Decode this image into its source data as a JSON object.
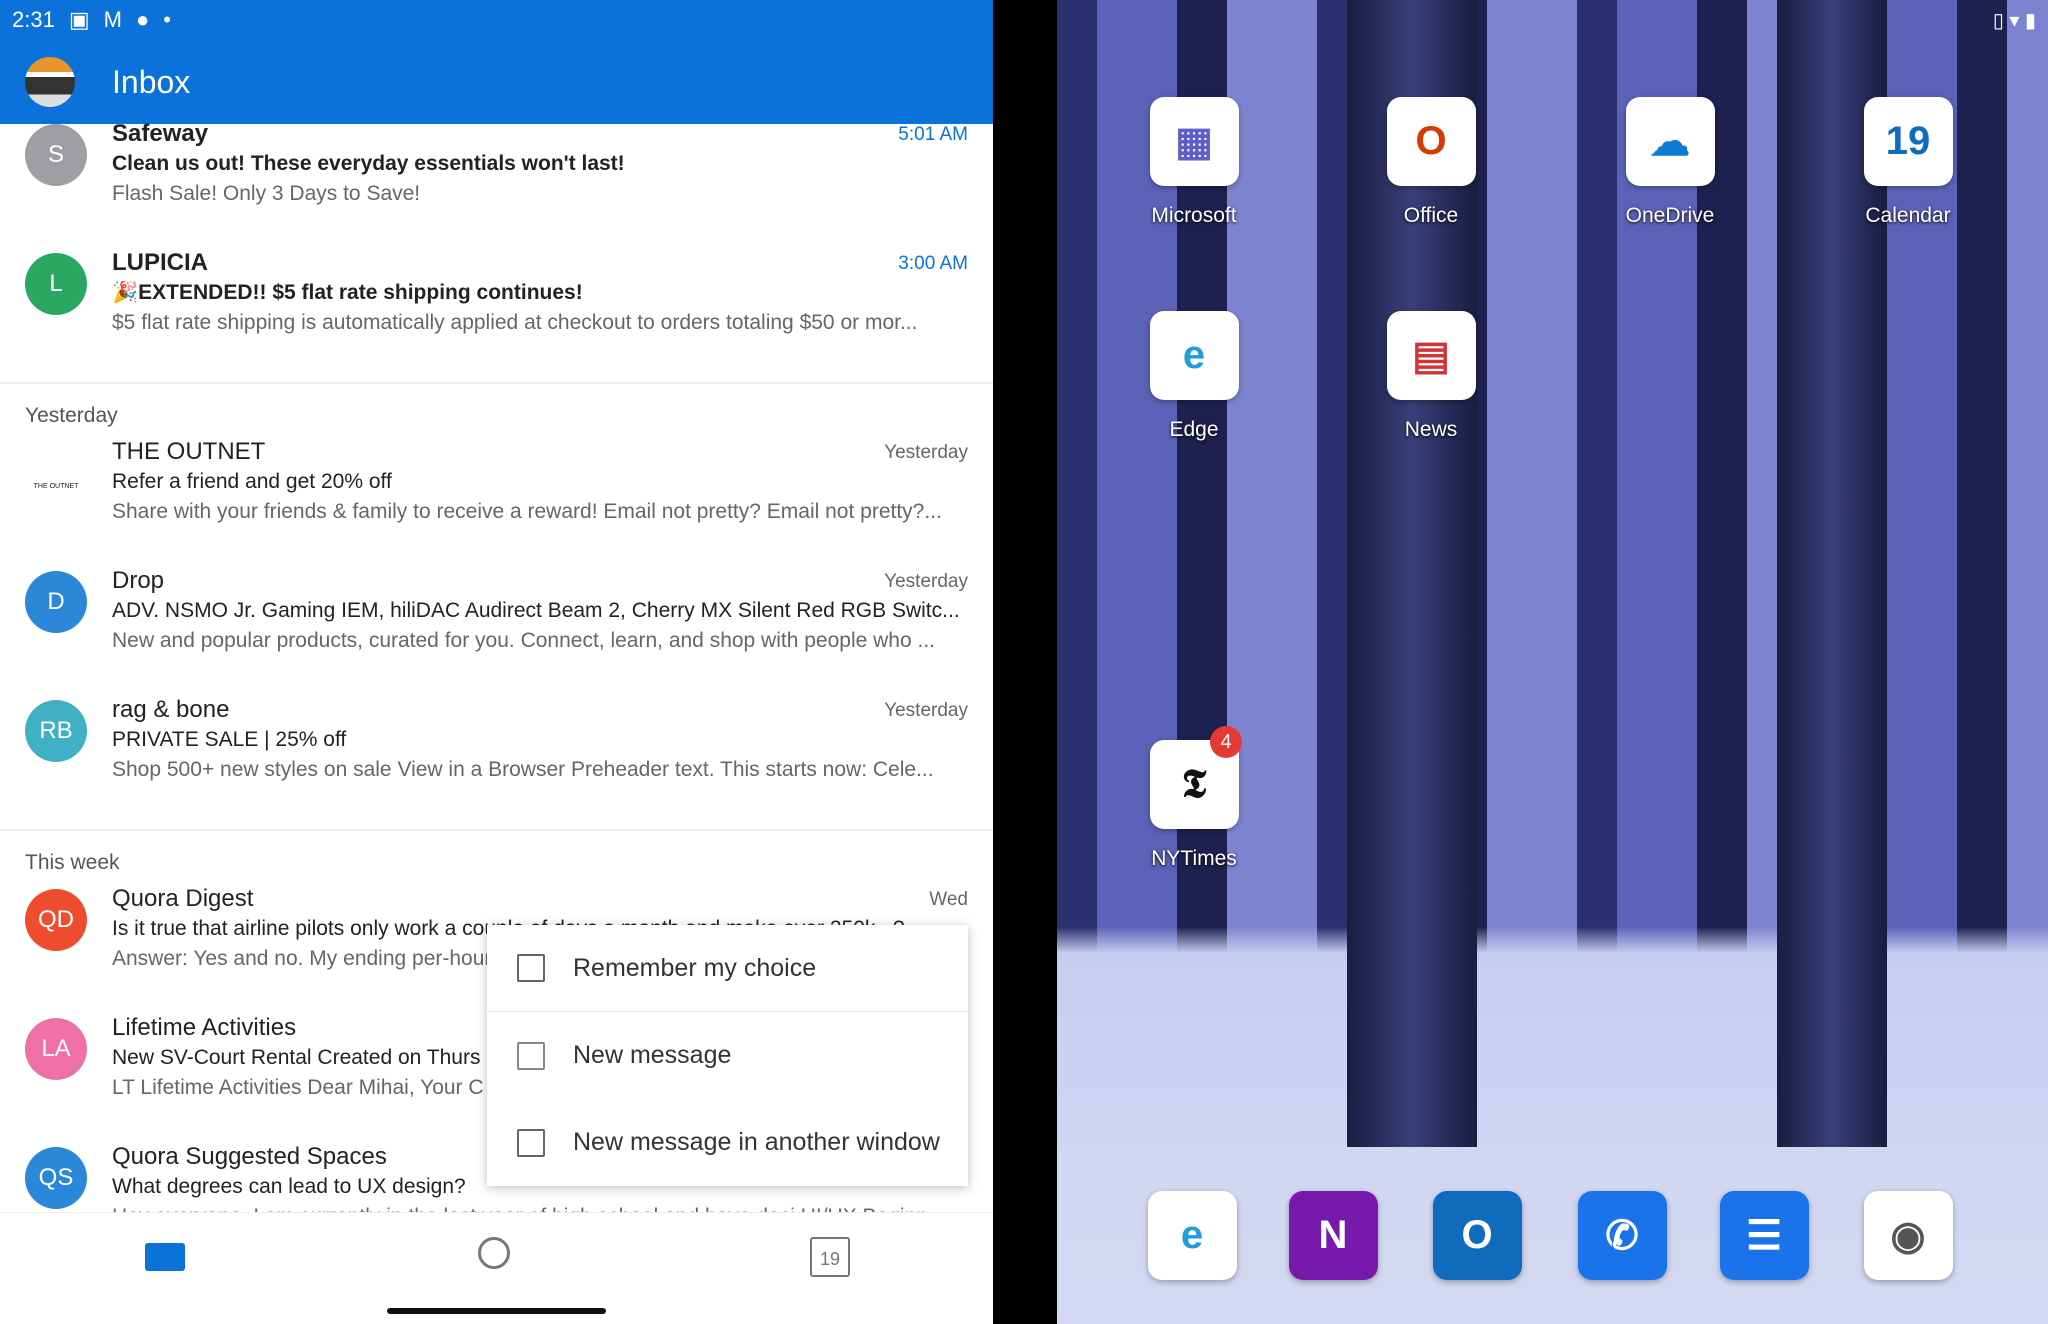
{
  "status_bar": {
    "time": "2:31",
    "right_icons": [
      "vibrate-icon",
      "wifi-icon",
      "battery-icon"
    ]
  },
  "header": {
    "title": "Inbox"
  },
  "emails": [
    {
      "avatar": "S",
      "color": "#9e9ea3",
      "sender": "Safeway",
      "subject": "Clean us out! These everyday essentials won't last!",
      "preview": "Flash Sale! Only 3 Days to Save!",
      "time": "5:01 AM",
      "unread": true
    },
    {
      "avatar": "L",
      "color": "#2aa862",
      "sender": "LUPICIA",
      "subject": "🎉EXTENDED!! $5 flat rate shipping continues!",
      "preview": "$5 flat rate shipping is automatically applied at checkout to orders totaling $50 or mor...",
      "time": "3:00 AM",
      "unread": true
    },
    {
      "section": "Yesterday"
    },
    {
      "avatar": "THE OUTNET",
      "color": "#ffffff",
      "sender": "THE OUTNET",
      "subject": "Refer a friend and get 20% off",
      "preview": "Share with your friends & family to receive a reward! Email not pretty? Email not pretty?...",
      "time": "Yesterday"
    },
    {
      "avatar": "D",
      "color": "#2b88d8",
      "sender": "Drop",
      "subject": "ADV. NSMO Jr. Gaming IEM, hiliDAC Audirect Beam 2, Cherry MX Silent Red RGB Switc...",
      "preview": "New and popular products, curated for you. Connect, learn, and shop with people who ...",
      "time": "Yesterday"
    },
    {
      "avatar": "RB",
      "color": "#3fb1c3",
      "sender": "rag & bone",
      "subject": "PRIVATE SALE | 25% off",
      "preview": "Shop 500+ new styles on sale View in a Browser Preheader text. This starts now: Cele...",
      "time": "Yesterday"
    },
    {
      "section": "This week"
    },
    {
      "avatar": "QD",
      "color": "#ef4d30",
      "sender": "Quora Digest",
      "subject": "Is it true that airline pilots only work a couple of days a month and make over 250k...?",
      "preview": "Answer: Yes and no. My ending per-hour",
      "time": "Wed"
    },
    {
      "avatar": "LA",
      "color": "#ef6fa7",
      "sender": "Lifetime Activities",
      "subject": "New SV-Court Rental Created on Thurs",
      "preview": "LT Lifetime Activities Dear Mihai, Your C",
      "time": ""
    },
    {
      "avatar": "QS",
      "color": "#2b88d8",
      "sender": "Quora Suggested Spaces",
      "subject": "What degrees can lead to UX design?",
      "preview": "Hey everyone, I am currently in the last year of high school and have deci UI/UX Beginn...",
      "time": ""
    }
  ],
  "context_menu": {
    "remember": "Remember my choice",
    "new_message": "New message",
    "new_window": "New message in another window"
  },
  "bottom_nav": {
    "calendar_day": "19"
  },
  "home": {
    "apps": [
      {
        "label": "Microsoft",
        "glyph": "▦",
        "color": "#5b5fc7"
      },
      {
        "label": "Office",
        "glyph": "O",
        "color": "#d83b01"
      },
      {
        "label": "OneDrive",
        "glyph": "☁",
        "color": "#0f78d4"
      },
      {
        "label": "Calendar",
        "glyph": "19",
        "color": "#0f6cbd"
      },
      {
        "label": "Edge",
        "glyph": "e",
        "color": "#1f9bde"
      },
      {
        "label": "News",
        "glyph": "▤",
        "color": "#d13438"
      },
      {
        "label": "NYTimes",
        "glyph": "𝕿",
        "color": "#111",
        "badge": "4"
      }
    ],
    "dock": [
      {
        "name": "edge",
        "glyph": "e",
        "color": "#1f9bde",
        "bg": "#fff"
      },
      {
        "name": "onenote",
        "glyph": "N",
        "color": "#fff",
        "bg": "#7719aa"
      },
      {
        "name": "outlook",
        "glyph": "O",
        "color": "#fff",
        "bg": "#0f6cbd"
      },
      {
        "name": "phone",
        "glyph": "✆",
        "color": "#fff",
        "bg": "#1a73e8"
      },
      {
        "name": "messages",
        "glyph": "☰",
        "color": "#fff",
        "bg": "#1a73e8"
      },
      {
        "name": "camera",
        "glyph": "◉",
        "color": "#555",
        "bg": "#fff"
      }
    ]
  }
}
